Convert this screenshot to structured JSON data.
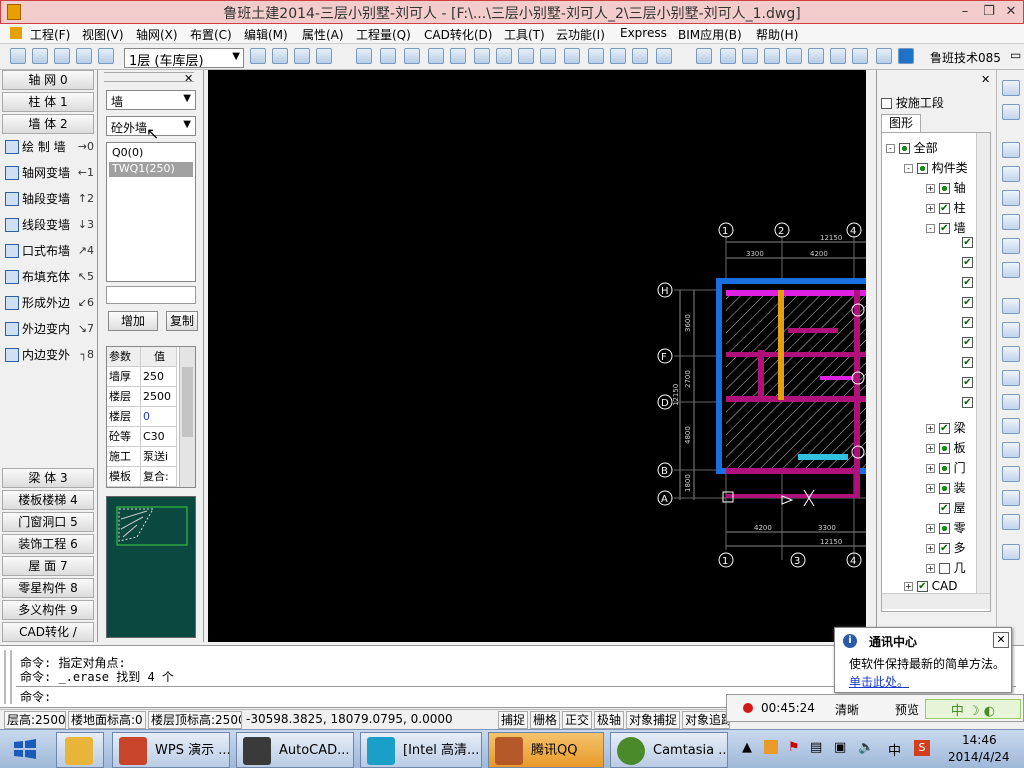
{
  "window": {
    "title": "鲁班土建2014-三层小别墅-刘可人 - [F:\\...\\三层小别墅-刘可人_2\\三层小别墅-刘可人_1.dwg]"
  },
  "menu": [
    "工程(F)",
    "视图(V)",
    "轴网(X)",
    "布置(C)",
    "编辑(M)",
    "属性(A)",
    "工程量(Q)",
    "CAD转化(D)",
    "工具(T)",
    "云功能(I)",
    "Express",
    "BIM应用(B)",
    "帮助(H)"
  ],
  "toolbar": {
    "floor": "1层 (车库层)",
    "user": "鲁班技术085"
  },
  "leftnav": {
    "top_tabs": [
      {
        "label": "轴  网 0"
      },
      {
        "label": "柱  体 1"
      },
      {
        "label": "墙  体 2"
      }
    ],
    "tools": [
      {
        "label": "绘 制 墙",
        "sc": "→0"
      },
      {
        "label": "轴网变墙",
        "sc": "←1"
      },
      {
        "label": "轴段变墙",
        "sc": "↑2"
      },
      {
        "label": "线段变墙",
        "sc": "↓3"
      },
      {
        "label": "口式布墙",
        "sc": "↗4"
      },
      {
        "label": "布填充体",
        "sc": "↖5"
      },
      {
        "label": "形成外边",
        "sc": "↙6"
      },
      {
        "label": "外边变内",
        "sc": "↘7"
      },
      {
        "label": "内边变外",
        "sc": "┐8"
      }
    ],
    "bottom_tabs": [
      {
        "label": "梁  体 3"
      },
      {
        "label": "楼板楼梯 4"
      },
      {
        "label": "门窗洞口 5"
      },
      {
        "label": "装饰工程 6"
      },
      {
        "label": "屋  面 7"
      },
      {
        "label": "零星构件 8"
      },
      {
        "label": "多义构件 9"
      },
      {
        "label": "CAD转化 /"
      }
    ]
  },
  "component": {
    "type": "墙",
    "subtype": "砼外墙",
    "items": [
      "Q0(0)",
      "TWQ1(250)"
    ],
    "selected_index": 1,
    "add_label": "增加",
    "copy_label": "复制",
    "prop_headers": [
      "参数",
      "值"
    ],
    "props": [
      {
        "k": "墙厚",
        "v": "250"
      },
      {
        "k": "楼层",
        "v": "2500"
      },
      {
        "k": "楼层",
        "v": "0"
      },
      {
        "k": "砼等",
        "v": "C30"
      },
      {
        "k": "施工",
        "v": "泵送i"
      },
      {
        "k": "模板",
        "v": "复合:"
      }
    ]
  },
  "drawing": {
    "top_axes": [
      "1",
      "2",
      "4"
    ],
    "bottom_axes": [
      "1",
      "3",
      "4"
    ],
    "left_axes": [
      "H",
      "F",
      "D",
      "B",
      "A"
    ],
    "top_dims": [
      "3300",
      "4200",
      "12150"
    ],
    "bottom_dims": [
      "4200",
      "3300",
      "12150"
    ],
    "left_dims": [
      "3600",
      "2700",
      "4800",
      "1800",
      "12150"
    ]
  },
  "rightpanel": {
    "checkbox_label": "按施工段",
    "tab": "图形",
    "tree": [
      {
        "label": "全部",
        "level": 0
      },
      {
        "label": "构件类",
        "level": 1
      },
      {
        "label": "轴",
        "level": 2
      },
      {
        "label": "柱",
        "level": 2
      },
      {
        "label": "墙",
        "level": 2
      },
      {
        "label": "梁",
        "level": 2
      },
      {
        "label": "板",
        "level": 2
      },
      {
        "label": "门",
        "level": 2
      },
      {
        "label": "装",
        "level": 2
      },
      {
        "label": "屋",
        "level": 2
      },
      {
        "label": "零",
        "level": 2
      },
      {
        "label": "多",
        "level": 2
      },
      {
        "label": "几",
        "level": 2
      },
      {
        "label": "CAD",
        "level": 1
      }
    ]
  },
  "command": {
    "lines": [
      "命令: 指定对角点:",
      "命令: _.erase 找到 4 个",
      "命令:"
    ]
  },
  "status": {
    "floor_height": "层高:2500",
    "floor_elev": "楼地面标高:0",
    "top_elev": "楼层顶标高:2500",
    "coords": "-30598.3825, 18079.0795, 0.0000",
    "toggles": [
      "捕捉",
      "栅格",
      "正交",
      "极轴",
      "对象捕捉",
      "对象追踪"
    ]
  },
  "notify": {
    "title": "通讯中心",
    "body": "使软件保持最新的简单方法。",
    "link": "单击此处。"
  },
  "recorder": {
    "time": "00:45:24",
    "clear": "清晰",
    "preview": "预览"
  },
  "ime": "中",
  "taskbar": {
    "tasks": [
      {
        "label": "",
        "color": "#e9b43a"
      },
      {
        "label": "WPS 演示 ...",
        "color": "#c8442b"
      },
      {
        "label": "AutoCAD...",
        "color": "#3a3a3a"
      },
      {
        "label": "[Intel 高清...",
        "color": "#1aa0c8"
      },
      {
        "label": "腾讯QQ",
        "color": "#b5582a"
      },
      {
        "label": "Camtasia ...",
        "color": "#4a8a2a"
      }
    ],
    "time": "14:46",
    "date": "2014/4/24"
  }
}
